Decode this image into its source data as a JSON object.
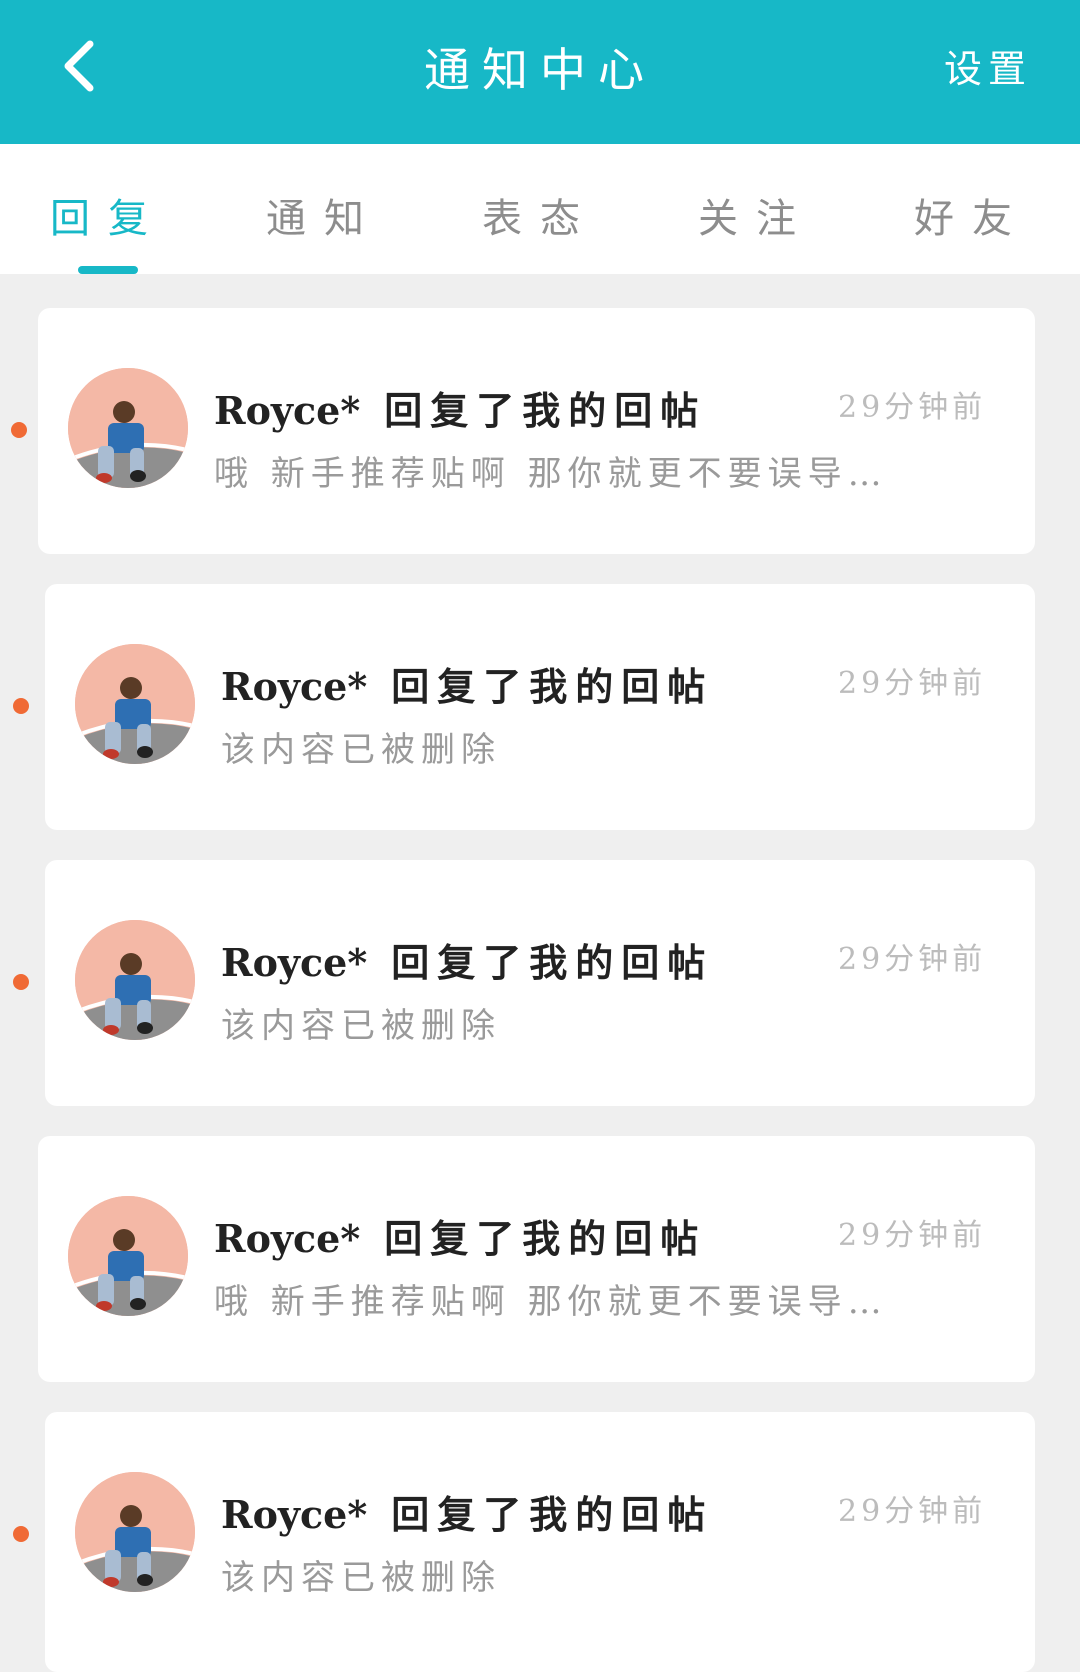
{
  "header": {
    "title": "通知中心",
    "settings_label": "设置",
    "back_icon": "chevron-left-icon"
  },
  "tabs": [
    {
      "label": "回复",
      "active": true
    },
    {
      "label": "通知",
      "active": false
    },
    {
      "label": "表态",
      "active": false
    },
    {
      "label": "关注",
      "active": false
    },
    {
      "label": "好友",
      "active": false
    }
  ],
  "notifications": [
    {
      "user": "Royce*",
      "action": "回复了我的回帖",
      "time": "29分钟前",
      "content": "哦  新手推荐贴啊  那你就更不要误导…",
      "unread": true
    },
    {
      "user": "Royce*",
      "action": "回复了我的回帖",
      "time": "29分钟前",
      "content": "该内容已被删除",
      "unread": true
    },
    {
      "user": "Royce*",
      "action": "回复了我的回帖",
      "time": "29分钟前",
      "content": "该内容已被删除",
      "unread": true
    },
    {
      "user": "Royce*",
      "action": "回复了我的回帖",
      "time": "29分钟前",
      "content": "哦  新手推荐贴啊  那你就更不要误导…",
      "unread": false
    },
    {
      "user": "Royce*",
      "action": "回复了我的回帖",
      "time": "29分钟前",
      "content": "该内容已被删除",
      "unread": true
    }
  ],
  "colors": {
    "accent": "#17b8c7",
    "unread_dot": "#f06a35",
    "background": "#efefef"
  }
}
